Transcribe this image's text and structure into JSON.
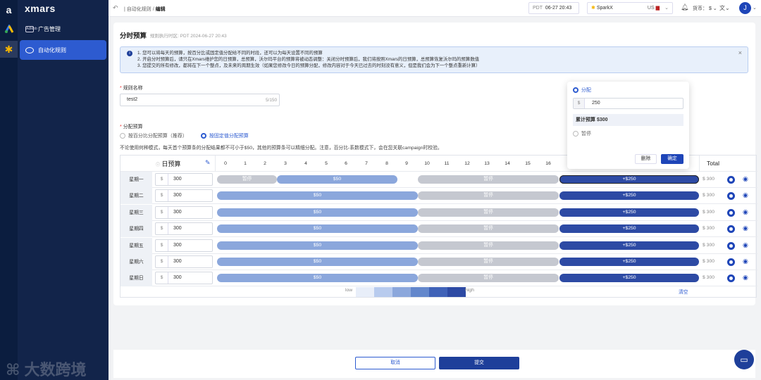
{
  "app": {
    "logo": "xmars"
  },
  "sidebar": {
    "items": [
      {
        "label": "广告管理",
        "icon": "AdMob"
      },
      {
        "label": "自动化规则"
      }
    ]
  },
  "topbar": {
    "breadcrumb": "自动化规则",
    "current": "编辑",
    "tz": "PDT",
    "time": "06-27 20:43",
    "store": "SparkX",
    "region": "US",
    "currency_label": "货币：",
    "currency": "$",
    "avatar": "J"
  },
  "page": {
    "title": "分时预算",
    "tz_note": "规则执行时区: PDT 2024-06-27 20:43",
    "info": [
      "1. 您可以将每天的预算，按百分比或固定值分配给不同的时段，还可以为每天设置不同的预算",
      "2. 开启分时预算后，请只在Xmars维护您的日预算，总预算，沃尔玛平台的预算将被动态调整：关闭分时预算后，我们将按照Xmars的日预算，总预算恢复沃尔玛的预算数值",
      "3. 您提交的所有修改，都将在下一个整点，及未来的周期生效（如果您修改今日的预算分配，修改内容对于今天已过去的时刻没有意义，但是我们会为下一个整点重新计算）"
    ],
    "close": "×",
    "rule_name_label": "规则名称",
    "rule_name_value": "test2",
    "rule_name_count": "5/150",
    "alloc_label": "分配预算",
    "opt_percent": "按百分比分配预算（推荐）",
    "opt_fixed": "按固定值分配预算",
    "note": "不论使用何种模式，每天首个预算条的分配结果都不可小于$50，其他的预算条可以精细分配。注意，百分比-系数模式下，会在您关联campaign时校验。"
  },
  "table": {
    "daily_budget": "日预算",
    "total": "Total",
    "hours": [
      "0",
      "1",
      "2",
      "3",
      "4",
      "5",
      "6",
      "7",
      "8",
      "9",
      "10",
      "11",
      "12",
      "13",
      "14",
      "15",
      "16",
      "23"
    ],
    "currency_symbol": "$",
    "rows": [
      {
        "day": "星期一",
        "budget": "300",
        "total": "$ 300",
        "bars": [
          "暂停",
          "$50",
          "暂停",
          "+$250"
        ]
      },
      {
        "day": "星期二",
        "budget": "300",
        "total": "$ 300",
        "bars": [
          "$50",
          "暂停",
          "+$250"
        ]
      },
      {
        "day": "星期三",
        "budget": "300",
        "total": "$ 300",
        "bars": [
          "$50",
          "暂停",
          "+$250"
        ]
      },
      {
        "day": "星期四",
        "budget": "300",
        "total": "$ 300",
        "bars": [
          "$50",
          "暂停",
          "+$250"
        ]
      },
      {
        "day": "星期五",
        "budget": "300",
        "total": "$ 300",
        "bars": [
          "$50",
          "暂停",
          "+$250"
        ]
      },
      {
        "day": "星期六",
        "budget": "300",
        "total": "$ 300",
        "bars": [
          "$50",
          "暂停",
          "+$250"
        ]
      },
      {
        "day": "星期日",
        "budget": "300",
        "total": "$ 300",
        "bars": [
          "$50",
          "暂停",
          "+$250"
        ]
      }
    ],
    "legend_low": "low",
    "legend_high": "high",
    "legend_colors": [
      "#e8eef9",
      "#b8cbee",
      "#8ba7dc",
      "#6387cc",
      "#3f62b8",
      "#2d4aa4"
    ],
    "clear": "清空"
  },
  "popup": {
    "allocate": "分配",
    "value": "250",
    "cumulative": "累计预算  $300",
    "pause": "暂停",
    "delete": "删除",
    "confirm": "确定"
  },
  "footer": {
    "cancel": "取消",
    "submit": "提交"
  },
  "watermark": "大数跨境"
}
